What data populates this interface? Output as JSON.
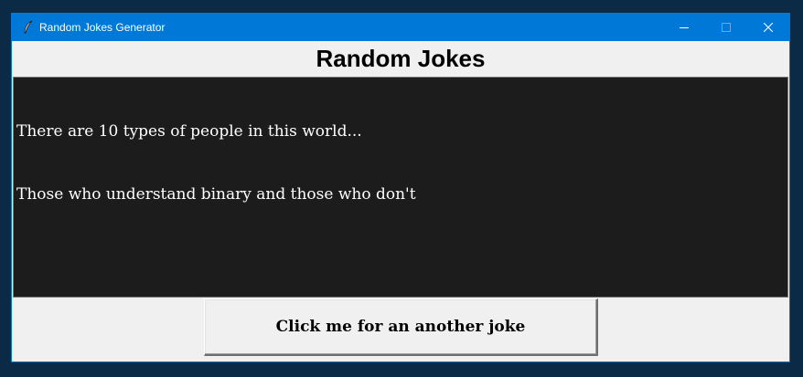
{
  "window": {
    "title": "Random Jokes Generator",
    "icons": {
      "app": "feather-icon",
      "minimize": "minimize-icon",
      "maximize": "maximize-icon",
      "close": "close-icon"
    },
    "colors": {
      "titlebar": "#0078d7",
      "content_bg": "#f0f0f0"
    }
  },
  "main": {
    "heading": "Random Jokes",
    "joke": {
      "lines": [
        "There are 10 types of people in this world...",
        "Those who understand binary and those who don't"
      ],
      "colors": {
        "background": "#1c1c1c",
        "text": "#ffffff"
      }
    },
    "button_label": "Click me for an another joke"
  }
}
